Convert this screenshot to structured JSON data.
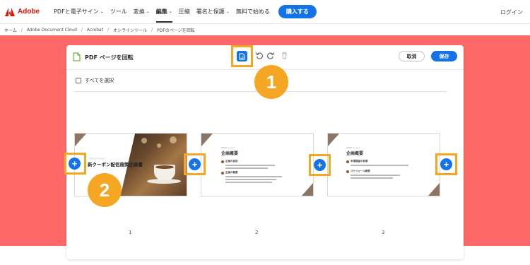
{
  "nav": {
    "brand": "Adobe",
    "items": [
      {
        "label": "PDFと電子サイン",
        "chevron": true
      },
      {
        "label": "ツール",
        "chevron": false
      },
      {
        "label": "変換",
        "chevron": true
      },
      {
        "label": "編集",
        "chevron": true,
        "active": true
      },
      {
        "label": "圧縮",
        "chevron": false
      },
      {
        "label": "署名と保護",
        "chevron": true
      },
      {
        "label": "無料で始める",
        "chevron": false
      }
    ],
    "buy_label": "購入する",
    "login_label": "ログイン"
  },
  "breadcrumb": [
    "ホーム",
    "Adobe Document Cloud",
    "Acrobat",
    "オンラインツール",
    "PDFのページを回転"
  ],
  "toolbar": {
    "title": "PDF ページを回転",
    "cancel_label": "取消",
    "save_label": "保存"
  },
  "select_all_label": "すべてを選択",
  "callouts": [
    "1",
    "2"
  ],
  "pages": [
    {
      "number": "1",
      "kicker": "○○○○ ○○○○",
      "title": "新クーポン配信施策企画書"
    },
    {
      "number": "2",
      "kicker": "2023 ○○○○",
      "title": "企画概要",
      "sections": [
        "企画の目的",
        "企画の概要"
      ]
    },
    {
      "number": "3",
      "kicker": "2023 ○○○○",
      "title": "企画概要",
      "sections": [
        "市場調査の背景",
        "スケジュール概要"
      ]
    }
  ],
  "colors": {
    "accent": "#1473e6",
    "highlight": "#f5a623",
    "stage": "#fe6967",
    "brand": "#eb1000"
  },
  "icons": [
    "adobe-logo-icon",
    "document-icon",
    "rotate-page-icon",
    "rotate-left-icon",
    "rotate-right-icon",
    "trash-icon",
    "plus-icon"
  ]
}
